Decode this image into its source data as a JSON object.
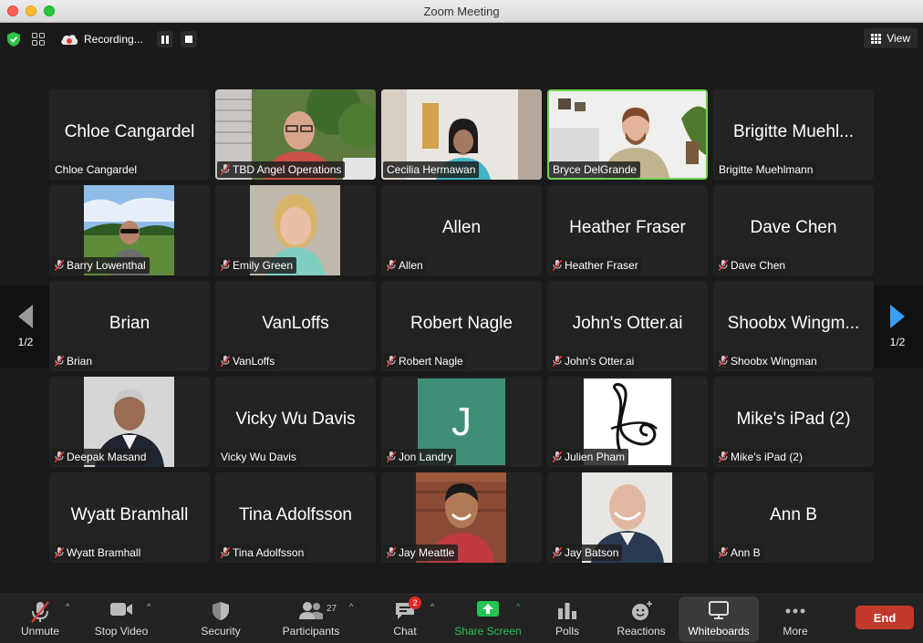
{
  "window": {
    "title": "Zoom Meeting"
  },
  "topbar": {
    "recording_label": "Recording...",
    "view_label": "View"
  },
  "pager": {
    "left_label": "1/2",
    "right_label": "1/2"
  },
  "tiles": [
    {
      "name": "Chloe Cangardel",
      "big": "Chloe Cangardel",
      "muted": false
    },
    {
      "name": "TBD Angel Operations",
      "big": "",
      "muted": true
    },
    {
      "name": "Cecilia Hermawan",
      "big": "",
      "muted": false
    },
    {
      "name": "Bryce DelGrande",
      "big": "",
      "muted": false
    },
    {
      "name": "Brigitte Muehlmann",
      "big": "Brigitte Muehl...",
      "muted": false
    },
    {
      "name": "Barry Lowenthal",
      "big": "",
      "muted": true
    },
    {
      "name": "Emily Green",
      "big": "",
      "muted": true
    },
    {
      "name": "Allen",
      "big": "Allen",
      "muted": true
    },
    {
      "name": "Heather Fraser",
      "big": "Heather Fraser",
      "muted": true
    },
    {
      "name": "Dave Chen",
      "big": "Dave Chen",
      "muted": true
    },
    {
      "name": "Brian",
      "big": "Brian",
      "muted": true
    },
    {
      "name": "VanLoffs",
      "big": "VanLoffs",
      "muted": true
    },
    {
      "name": "Robert Nagle",
      "big": "Robert Nagle",
      "muted": true
    },
    {
      "name": "John's Otter.ai",
      "big": "John's Otter.ai",
      "muted": true
    },
    {
      "name": "Shoobx Wingman",
      "big": "Shoobx Wingm...",
      "muted": true
    },
    {
      "name": "Deepak Masand",
      "big": "",
      "muted": true
    },
    {
      "name": "Vicky Wu Davis",
      "big": "Vicky Wu Davis",
      "muted": false
    },
    {
      "name": "Jon Landry",
      "big": "",
      "muted": true,
      "avatar_letter": "J"
    },
    {
      "name": "Julien Pham",
      "big": "",
      "muted": true
    },
    {
      "name": "Mike's iPad (2)",
      "big": "Mike's iPad (2)",
      "muted": true
    },
    {
      "name": "Wyatt Bramhall",
      "big": "Wyatt Bramhall",
      "muted": true
    },
    {
      "name": "Tina Adolfsson",
      "big": "Tina Adolfsson",
      "muted": true
    },
    {
      "name": "Jay Meattle",
      "big": "",
      "muted": true
    },
    {
      "name": "Jay Batson",
      "big": "",
      "muted": true
    },
    {
      "name": "Ann B",
      "big": "Ann B",
      "muted": true
    }
  ],
  "toolbar": {
    "unmute": "Unmute",
    "stop_video": "Stop Video",
    "security": "Security",
    "participants": "Participants",
    "participants_count": "27",
    "chat": "Chat",
    "chat_badge": "2",
    "share_screen": "Share Screen",
    "polls": "Polls",
    "reactions": "Reactions",
    "whiteboards": "Whiteboards",
    "more": "More",
    "end": "End"
  },
  "colors": {
    "active_speaker": "#6fd34e",
    "share_green": "#23c552",
    "end_red": "#c0392b",
    "avatar_teal": "#3f8f78"
  }
}
